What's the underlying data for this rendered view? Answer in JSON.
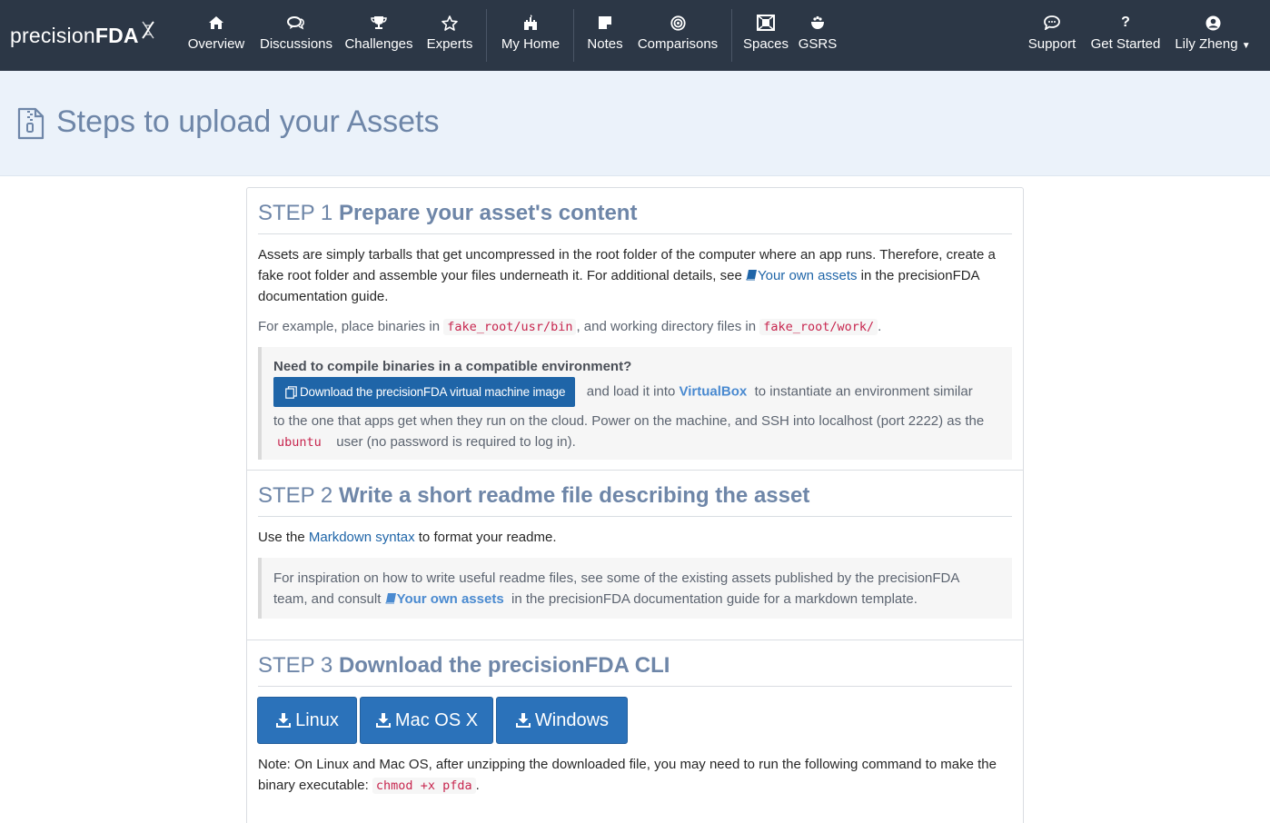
{
  "nav": {
    "logo_light": "precision",
    "logo_bold": "FDA",
    "items": [
      {
        "label": "Overview",
        "icon": "home-icon"
      },
      {
        "label": "Discussions",
        "icon": "comments-icon"
      },
      {
        "label": "Challenges",
        "icon": "trophy-icon"
      },
      {
        "label": "Experts",
        "icon": "star-icon"
      },
      {
        "label": "My Home",
        "icon": "castle-icon"
      },
      {
        "label": "Notes",
        "icon": "note-icon"
      },
      {
        "label": "Comparisons",
        "icon": "bullseye-icon"
      },
      {
        "label": "Spaces",
        "icon": "spaces-icon"
      },
      {
        "label": "GSRS",
        "icon": "gsrs-icon"
      }
    ],
    "right": [
      {
        "label": "Support",
        "icon": "chat-bubble-icon"
      },
      {
        "label": "Get Started",
        "icon": "question-icon"
      },
      {
        "label": "Lily Zheng",
        "icon": "user-icon"
      }
    ]
  },
  "header": {
    "title": "Steps to upload your Assets",
    "icon": "zip-file-icon"
  },
  "step1": {
    "num": "STEP 1",
    "name": "Prepare your asset's content",
    "p1_a": "Assets are simply tarballs that get uncompressed in the root folder of the computer where an app runs. Therefore, create a fake root folder and assemble your files underneath it. For additional details, see",
    "p1_link": "Your own assets",
    "p1_b": "in the precisionFDA documentation guide.",
    "p2_a": "For example, place binaries in",
    "p2_code1": "fake_root/usr/bin",
    "p2_b": ", and working directory files in",
    "p2_code2": "fake_root/work/",
    "p2_c": ".",
    "callout_title": "Need to compile binaries in a compatible environment?",
    "vm_button": "Download the precisionFDA virtual machine image",
    "callout_a": "and load it into",
    "callout_link": "VirtualBox",
    "callout_b": "to instantiate an environment similar",
    "callout_c": "to the one that apps get when they run on the cloud. Power on the machine, and SSH into localhost (port 2222) as the",
    "callout_code": "ubuntu",
    "callout_d": "user (no password is required to log in)."
  },
  "step2": {
    "num": "STEP 2",
    "name": "Write a short readme file describing the asset",
    "p1_a": "Use the",
    "p1_link": "Markdown syntax",
    "p1_b": "to format your readme.",
    "callout_a": "For inspiration on how to write useful readme files, see some of the existing assets published by the precisionFDA team, and consult",
    "callout_link": "Your own assets",
    "callout_b": "in the precisionFDA documentation guide for a markdown template."
  },
  "step3": {
    "num": "STEP 3",
    "name": "Download the precisionFDA CLI",
    "buttons": [
      "Linux",
      "Mac OS X",
      "Windows"
    ],
    "note_a": "Note: On Linux and Mac OS, after unzipping the downloaded file, you may need to run the following command to make the binary executable:",
    "note_code": "chmod +x pfda",
    "note_b": "."
  }
}
